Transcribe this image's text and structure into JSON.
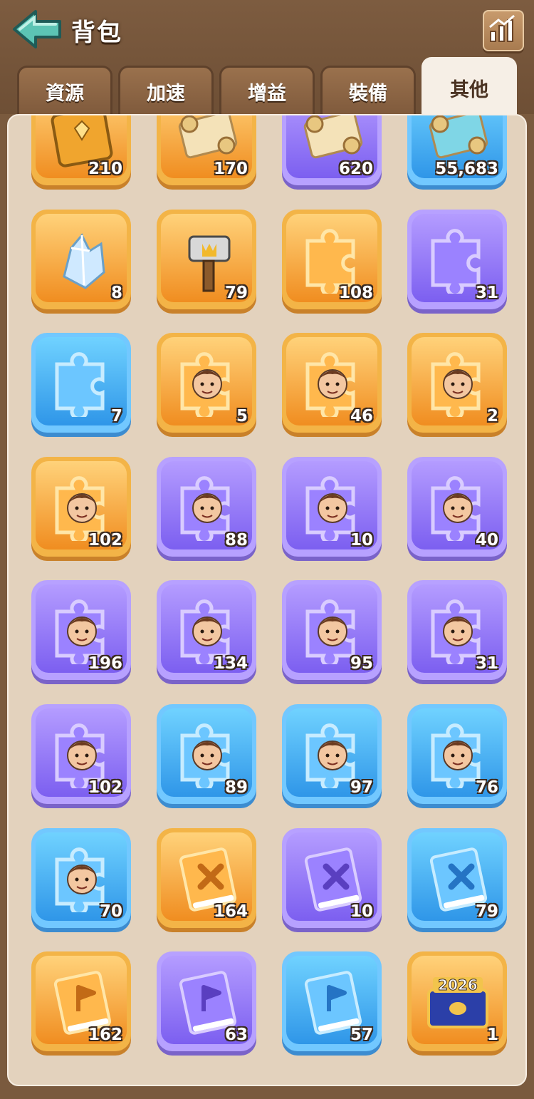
{
  "header": {
    "title": "背包",
    "back_icon": "back-arrow-icon",
    "stats_icon": "bar-chart-icon",
    "accent": "#5cc4b4"
  },
  "tabs": [
    {
      "label": "資源",
      "active": false
    },
    {
      "label": "加速",
      "active": false
    },
    {
      "label": "增益",
      "active": false
    },
    {
      "label": "裝備",
      "active": false
    },
    {
      "label": "其他",
      "active": true
    }
  ],
  "items": [
    {
      "icon": "golden-tome-icon",
      "rarity": "orange",
      "count": "210"
    },
    {
      "icon": "map-scroll-icon",
      "rarity": "orange",
      "count": "170"
    },
    {
      "icon": "rolled-scroll-icon",
      "rarity": "purple",
      "count": "620"
    },
    {
      "icon": "blueprint-scroll-icon",
      "rarity": "blue",
      "count": "55,683"
    },
    {
      "icon": "crystal-icon",
      "rarity": "orange",
      "count": "8"
    },
    {
      "icon": "crown-hammer-icon",
      "rarity": "orange",
      "count": "79"
    },
    {
      "icon": "orange-puzzle-piece-icon",
      "rarity": "orange",
      "count": "108"
    },
    {
      "icon": "purple-puzzle-piece-icon",
      "rarity": "purple",
      "count": "31"
    },
    {
      "icon": "blue-puzzle-piece-icon",
      "rarity": "blue",
      "count": "7"
    },
    {
      "icon": "hero-fragment-redhead-icon",
      "rarity": "orange",
      "count": "5"
    },
    {
      "icon": "hero-fragment-pharaoh-icon",
      "rarity": "orange",
      "count": "46"
    },
    {
      "icon": "hero-fragment-explorer-icon",
      "rarity": "orange",
      "count": "2"
    },
    {
      "icon": "hero-fragment-blonde-icon",
      "rarity": "orange",
      "count": "102"
    },
    {
      "icon": "hero-fragment-desert-icon",
      "rarity": "purple",
      "count": "88"
    },
    {
      "icon": "hero-fragment-witch-icon",
      "rarity": "purple",
      "count": "10"
    },
    {
      "icon": "hero-fragment-girl-icon",
      "rarity": "purple",
      "count": "40"
    },
    {
      "icon": "hero-fragment-redhair-icon",
      "rarity": "purple",
      "count": "196"
    },
    {
      "icon": "hero-fragment-princess-icon",
      "rarity": "purple",
      "count": "134"
    },
    {
      "icon": "hero-fragment-soldier-icon",
      "rarity": "purple",
      "count": "95"
    },
    {
      "icon": "hero-fragment-captain-icon",
      "rarity": "purple",
      "count": "31"
    },
    {
      "icon": "hero-fragment-bearded-icon",
      "rarity": "purple",
      "count": "102"
    },
    {
      "icon": "hero-fragment-archer-icon",
      "rarity": "blue",
      "count": "89"
    },
    {
      "icon": "hero-fragment-knight-icon",
      "rarity": "blue",
      "count": "97"
    },
    {
      "icon": "hero-fragment-elder-icon",
      "rarity": "blue",
      "count": "76"
    },
    {
      "icon": "hero-fragment-dwarf-icon",
      "rarity": "blue",
      "count": "70"
    },
    {
      "icon": "orange-sword-book-icon",
      "rarity": "orange",
      "count": "164"
    },
    {
      "icon": "purple-sword-book-icon",
      "rarity": "purple",
      "count": "10"
    },
    {
      "icon": "blue-sword-book-icon",
      "rarity": "blue",
      "count": "79"
    },
    {
      "icon": "orange-flag-book-icon",
      "rarity": "orange",
      "count": "162"
    },
    {
      "icon": "purple-flag-book-icon",
      "rarity": "purple",
      "count": "63"
    },
    {
      "icon": "blue-flag-book-icon",
      "rarity": "blue",
      "count": "57"
    },
    {
      "icon": "chest-2026-icon",
      "rarity": "orange",
      "count": "1",
      "badge": "2026"
    }
  ]
}
